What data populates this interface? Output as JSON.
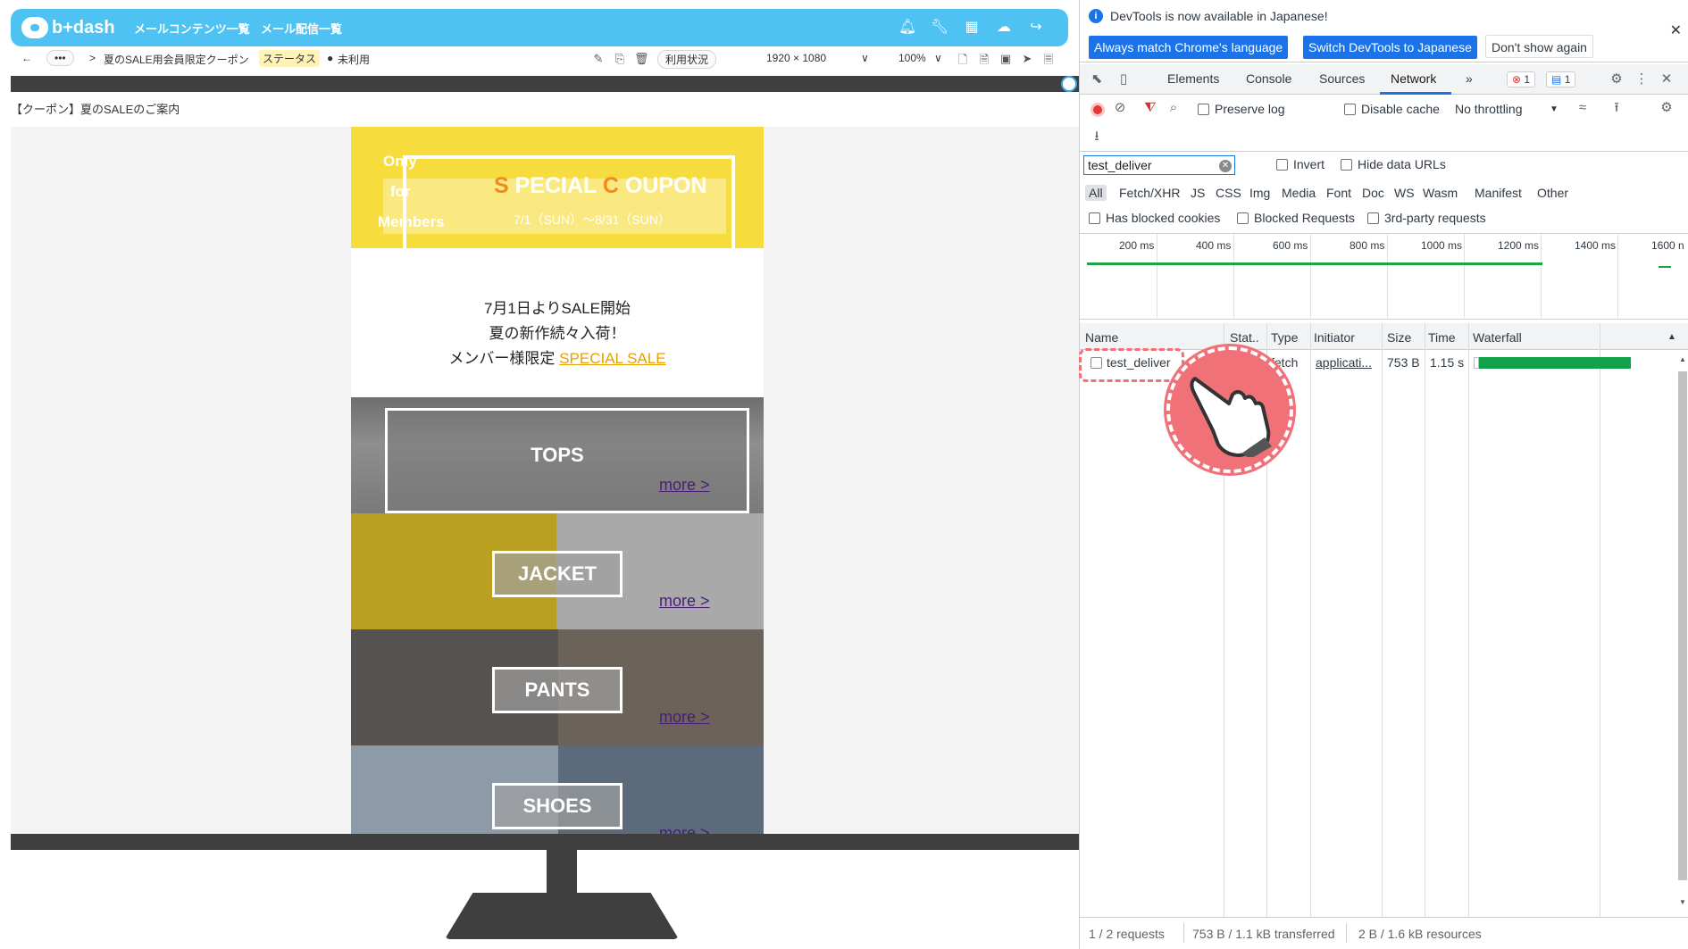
{
  "app": {
    "logo_text": "b+dash",
    "nav": [
      "メールコンテンツ一覧",
      "メール配信一覧"
    ],
    "breadcrumb_more": "•••",
    "breadcrumb_sep": ">",
    "breadcrumb_current": "夏のSALE用会員限定クーポン",
    "status_label": "ステータス",
    "status_value": "未利用",
    "usage_button": "利用状況",
    "resolution": "1920 × 1080",
    "zoom": "100%",
    "subject_line": "【クーポン】夏のSALEのご案内",
    "colors": {
      "topbar": "#4ec3f3",
      "accent": "#f7dc3d"
    }
  },
  "email": {
    "hero": {
      "only_lines": [
        "Only",
        "for",
        "Members"
      ],
      "title_s": "S",
      "title_s_rest": " PECIAL ",
      "title_c": "C",
      "title_c_rest": " OUPON",
      "dates": "7/1（SUN）～8/31（SUN）"
    },
    "intro": {
      "line1": "7月1日よりSALE開始",
      "line2": "夏の新作続々入荷！",
      "line3_prefix": "メンバー様限定 ",
      "line3_link": "SPECIAL SALE"
    },
    "categories": [
      {
        "label": "TOPS",
        "more": "more >"
      },
      {
        "label": "JACKET",
        "more": "more >"
      },
      {
        "label": "PANTS",
        "more": "more >"
      },
      {
        "label": "SHOES",
        "more": "more >"
      }
    ]
  },
  "devtools": {
    "info": {
      "message": "DevTools is now available in Japanese!",
      "btn_match": "Always match Chrome's language",
      "btn_switch": "Switch DevTools to Japanese",
      "btn_dismiss": "Don't show again"
    },
    "tabs": [
      "Elements",
      "Console",
      "Sources",
      "Network"
    ],
    "active_tab": "Network",
    "more_tabs": "»",
    "error_count": "1",
    "message_count": "1",
    "toolbar": {
      "preserve_log": "Preserve log",
      "disable_cache": "Disable cache",
      "throttling": "No throttling"
    },
    "filter": {
      "value": "test_deliver",
      "invert": "Invert",
      "hide_data_urls": "Hide data URLs",
      "types": [
        "All",
        "Fetch/XHR",
        "JS",
        "CSS",
        "Img",
        "Media",
        "Font",
        "Doc",
        "WS",
        "Wasm",
        "Manifest",
        "Other"
      ],
      "active_type": "All",
      "has_blocked_cookies": "Has blocked cookies",
      "blocked_requests": "Blocked Requests",
      "third_party": "3rd-party requests"
    },
    "timeline_ticks": [
      "200 ms",
      "400 ms",
      "600 ms",
      "800 ms",
      "1000 ms",
      "1200 ms",
      "1400 ms",
      "1600 n"
    ],
    "table": {
      "headers": [
        "Name",
        "Stat..",
        "Type",
        "Initiator",
        "Size",
        "Time",
        "Waterfall"
      ],
      "rows": [
        {
          "name": "test_deliver",
          "status": "",
          "type": "fetch",
          "initiator": "applicati...",
          "size": "753 B",
          "time": "1.15 s"
        }
      ]
    },
    "status": {
      "requests": "1 / 2 requests",
      "transferred": "753 B / 1.1 kB transferred",
      "resources": "2 B / 1.6 kB resources"
    },
    "colors": {
      "primary": "#1a73e8",
      "waterfall": "#12a14a",
      "record": "#e53935",
      "highlight": "#f07178"
    }
  }
}
